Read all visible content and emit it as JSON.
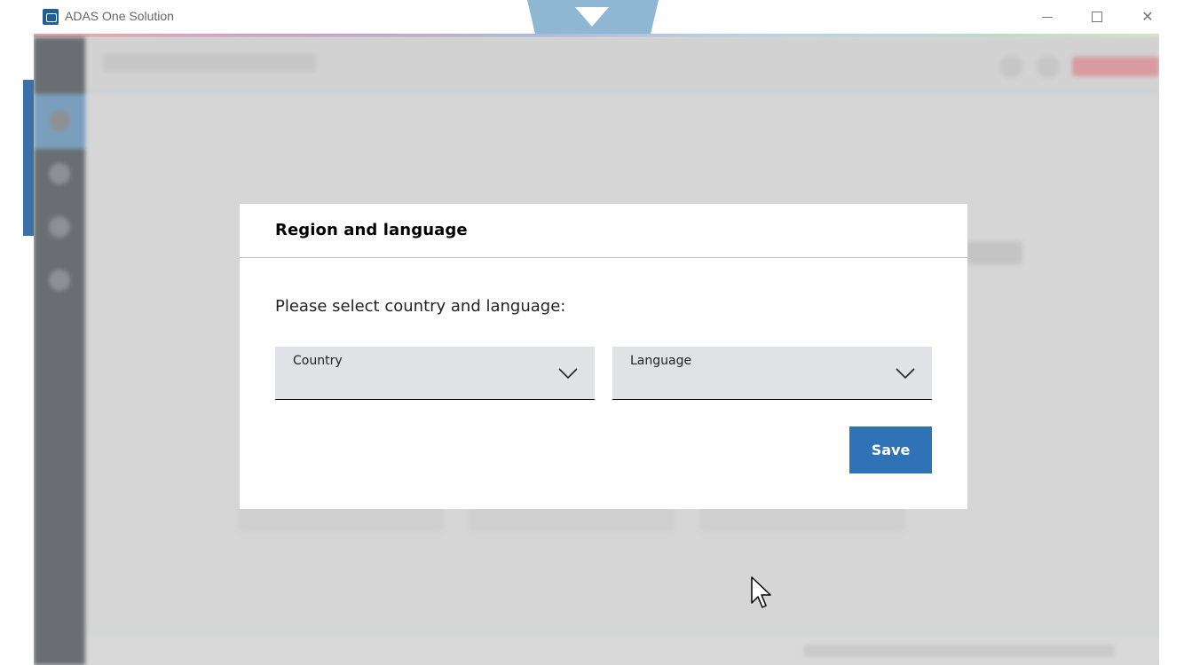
{
  "window": {
    "title": "ADAS One Solution",
    "controls": {
      "minimize_glyph": "minimize-icon",
      "maximize_glyph": "maximize-icon",
      "close_glyph": "✕"
    }
  },
  "dialog": {
    "title": "Region and language",
    "prompt": "Please select country and language:",
    "country_label": "Country",
    "language_label": "Language",
    "save_label": "Save"
  },
  "colors": {
    "primary": "#2f73b6",
    "field_bg": "#e0e2e5",
    "overlay": "#d6d6d6"
  }
}
